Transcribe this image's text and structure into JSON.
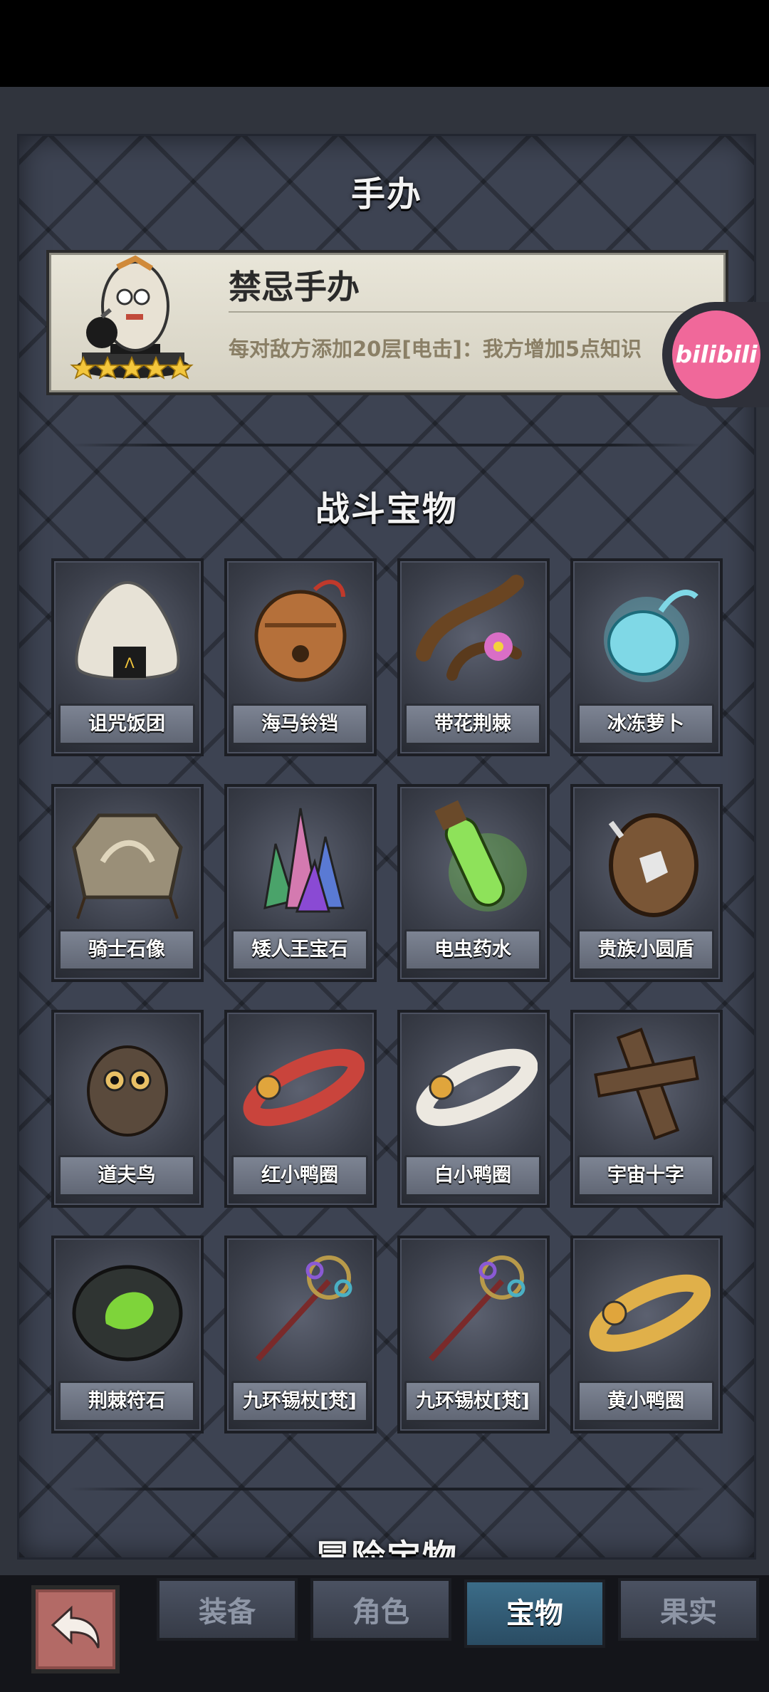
{
  "sections": {
    "figure_title": "手办",
    "battle_title": "战斗宝物",
    "adventure_title": "冒险宝物"
  },
  "figure": {
    "name": "禁忌手办",
    "description": "每对敌方添加20层[电击]：我方增加5点知识",
    "stars": 5,
    "icon": "figurine-icon"
  },
  "items": [
    {
      "label": "诅咒饭团",
      "icon": "rice-ball-icon"
    },
    {
      "label": "海马铃铛",
      "icon": "bell-icon"
    },
    {
      "label": "带花荆棘",
      "icon": "thorn-flower-icon"
    },
    {
      "label": "冰冻萝卜",
      "icon": "frozen-radish-icon"
    },
    {
      "label": "骑士石像",
      "icon": "stone-tablet-icon"
    },
    {
      "label": "矮人王宝石",
      "icon": "gem-cluster-icon"
    },
    {
      "label": "电虫药水",
      "icon": "potion-icon"
    },
    {
      "label": "贵族小圆盾",
      "icon": "round-shield-icon"
    },
    {
      "label": "道夫鸟",
      "icon": "owl-icon"
    },
    {
      "label": "红小鸭圈",
      "icon": "red-duck-ring-icon"
    },
    {
      "label": "白小鸭圈",
      "icon": "white-duck-ring-icon"
    },
    {
      "label": "宇宙十字",
      "icon": "wooden-cross-icon"
    },
    {
      "label": "荆棘符石",
      "icon": "rune-stone-icon"
    },
    {
      "label": "九环锡杖[梵]",
      "icon": "staff-icon"
    },
    {
      "label": "九环锡杖[梵]",
      "icon": "staff-icon"
    },
    {
      "label": "黄小鸭圈",
      "icon": "yellow-duck-ring-icon"
    }
  ],
  "badge": {
    "text": "bilibili"
  },
  "nav": {
    "back_icon": "back-arrow-icon",
    "tabs": [
      "装备",
      "角色",
      "宝物",
      "果实"
    ],
    "active_tab": "宝物"
  }
}
